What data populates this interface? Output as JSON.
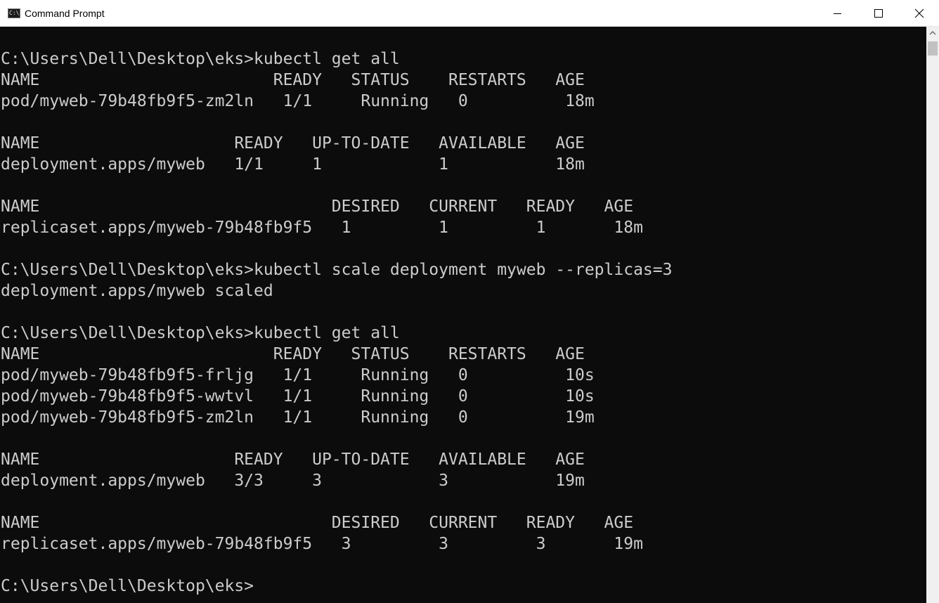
{
  "window": {
    "title": "Command Prompt",
    "icon_label": "C:\\."
  },
  "console": {
    "lines": [
      "C:\\Users\\Dell\\Desktop\\eks>kubectl get all",
      "NAME                        READY   STATUS    RESTARTS   AGE",
      "pod/myweb-79b48fb9f5-zm2ln   1/1     Running   0          18m",
      "",
      "NAME                    READY   UP-TO-DATE   AVAILABLE   AGE",
      "deployment.apps/myweb   1/1     1            1           18m",
      "",
      "NAME                              DESIRED   CURRENT   READY   AGE",
      "replicaset.apps/myweb-79b48fb9f5   1         1         1       18m",
      "",
      "C:\\Users\\Dell\\Desktop\\eks>kubectl scale deployment myweb --replicas=3",
      "deployment.apps/myweb scaled",
      "",
      "C:\\Users\\Dell\\Desktop\\eks>kubectl get all",
      "NAME                        READY   STATUS    RESTARTS   AGE",
      "pod/myweb-79b48fb9f5-frljg   1/1     Running   0          10s",
      "pod/myweb-79b48fb9f5-wwtvl   1/1     Running   0          10s",
      "pod/myweb-79b48fb9f5-zm2ln   1/1     Running   0          19m",
      "",
      "NAME                    READY   UP-TO-DATE   AVAILABLE   AGE",
      "deployment.apps/myweb   3/3     3            3           19m",
      "",
      "NAME                              DESIRED   CURRENT   READY   AGE",
      "replicaset.apps/myweb-79b48fb9f5   3         3         3       19m",
      "",
      "C:\\Users\\Dell\\Desktop\\eks>"
    ]
  },
  "colors": {
    "console_bg": "#0c0c0c",
    "console_text": "#cccccc",
    "titlebar_bg": "#ffffff"
  },
  "icons": {
    "minimize": "minimize-icon",
    "maximize": "maximize-icon",
    "close": "close-icon"
  }
}
